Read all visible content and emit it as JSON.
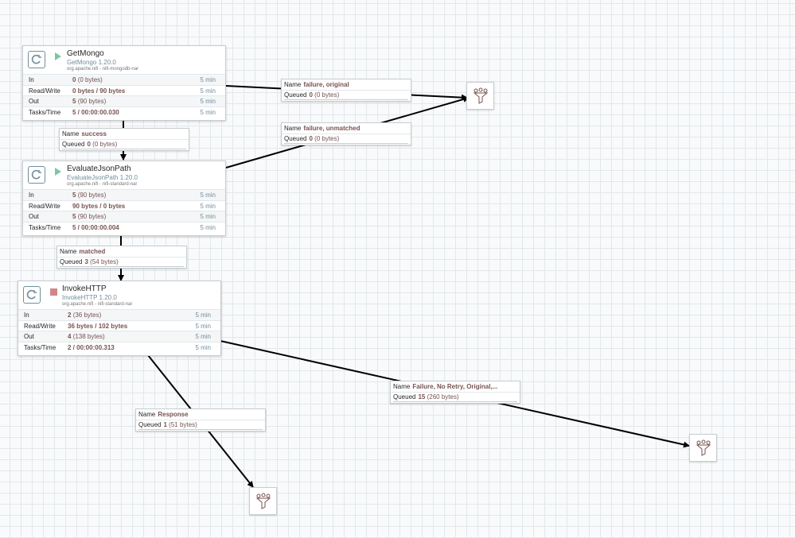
{
  "canvas": {
    "colors": {
      "grid": "#e3e8eb",
      "accent": "#728e9b",
      "value": "#775351",
      "running": "#7dc7a0",
      "stopped": "#d18686"
    }
  },
  "processors": [
    {
      "name": "GetMongo",
      "type": "GetMongo 1.20.0",
      "bundle": "org.apache.nifi - nifi-mongodb-nar",
      "state": "running",
      "state_icon": "play-icon",
      "stats": [
        {
          "label": "In",
          "value": "0",
          "size": "(0 bytes)",
          "time": "5 min"
        },
        {
          "label": "Read/Write",
          "value": "0 bytes / 90 bytes",
          "size": "",
          "time": "5 min"
        },
        {
          "label": "Out",
          "value": "5",
          "size": "(90 bytes)",
          "time": "5 min"
        },
        {
          "label": "Tasks/Time",
          "value": "5 / 00:00:00.030",
          "size": "",
          "time": "5 min"
        }
      ]
    },
    {
      "name": "EvaluateJsonPath",
      "type": "EvaluateJsonPath 1.20.0",
      "bundle": "org.apache.nifi - nifi-standard-nar",
      "state": "running",
      "state_icon": "play-icon",
      "stats": [
        {
          "label": "In",
          "value": "5",
          "size": "(90 bytes)",
          "time": "5 min"
        },
        {
          "label": "Read/Write",
          "value": "90 bytes / 0 bytes",
          "size": "",
          "time": "5 min"
        },
        {
          "label": "Out",
          "value": "5",
          "size": "(90 bytes)",
          "time": "5 min"
        },
        {
          "label": "Tasks/Time",
          "value": "5 / 00:00:00.004",
          "size": "",
          "time": "5 min"
        }
      ]
    },
    {
      "name": "InvokeHTTP",
      "type": "InvokeHTTP 1.20.0",
      "bundle": "org.apache.nifi - nifi-standard-nar",
      "state": "stopped",
      "state_icon": "stop-icon",
      "stats": [
        {
          "label": "In",
          "value": "2",
          "size": "(36 bytes)",
          "time": "5 min"
        },
        {
          "label": "Read/Write",
          "value": "36 bytes / 102 bytes",
          "size": "",
          "time": "5 min"
        },
        {
          "label": "Out",
          "value": "4",
          "size": "(138 bytes)",
          "time": "5 min"
        },
        {
          "label": "Tasks/Time",
          "value": "2 / 00:00:00.313",
          "size": "",
          "time": "5 min"
        }
      ]
    }
  ],
  "connections": [
    {
      "name_label": "Name",
      "name": "success",
      "queued_label": "Queued",
      "queued": "0",
      "queued_size": "(0 bytes)"
    },
    {
      "name_label": "Name",
      "name": "failure, original",
      "queued_label": "Queued",
      "queued": "0",
      "queued_size": "(0 bytes)"
    },
    {
      "name_label": "Name",
      "name": "failure, unmatched",
      "queued_label": "Queued",
      "queued": "0",
      "queued_size": "(0 bytes)"
    },
    {
      "name_label": "Name",
      "name": "matched",
      "queued_label": "Queued",
      "queued": "3",
      "queued_size": "(54 bytes)"
    },
    {
      "name_label": "Name",
      "name": "Failure, No Retry, Original,...",
      "queued_label": "Queued",
      "queued": "15",
      "queued_size": "(260 bytes)"
    },
    {
      "name_label": "Name",
      "name": "Response",
      "queued_label": "Queued",
      "queued": "1",
      "queued_size": "(51 bytes)"
    }
  ],
  "funnels": [
    {
      "icon": "funnel-icon"
    },
    {
      "icon": "funnel-icon"
    },
    {
      "icon": "funnel-icon"
    }
  ]
}
